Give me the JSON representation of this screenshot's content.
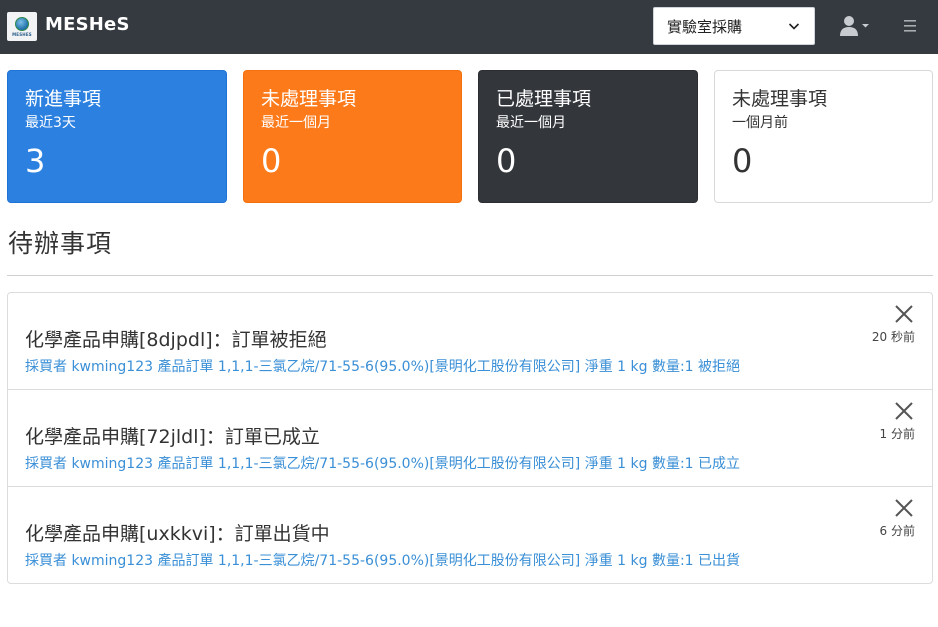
{
  "navbar": {
    "logo_text": "MESHES",
    "brand": "MESHeS",
    "role_select": "實驗室採購",
    "user_icon": "user-icon",
    "menu_icon": "hamburger-icon"
  },
  "cards": [
    {
      "title": "新進事項",
      "subtitle": "最近3天",
      "count": "3",
      "color": "#2b80e0"
    },
    {
      "title": "未處理事項",
      "subtitle": "最近一個月",
      "count": "0",
      "color": "#fd7a1a"
    },
    {
      "title": "已處理事項",
      "subtitle": "最近一個月",
      "count": "0",
      "color": "#33373c"
    },
    {
      "title": "未處理事項",
      "subtitle": "一個月前",
      "count": "0",
      "color": "#ffffff"
    }
  ],
  "section_title": "待辦事項",
  "todos": [
    {
      "title": "化學產品申購[8djpdl]：訂單被拒絕",
      "description": "採買者 kwming123 產品訂單 1,1,1-三氯乙烷/71-55-6(95.0%)[景明化工股份有限公司] 淨重 1 kg 數量:1 被拒絕",
      "time": "20 秒前"
    },
    {
      "title": "化學產品申購[72jldl]：訂單已成立",
      "description": "採買者 kwming123 產品訂單 1,1,1-三氯乙烷/71-55-6(95.0%)[景明化工股份有限公司] 淨重 1 kg 數量:1 已成立",
      "time": "1 分前"
    },
    {
      "title": "化學產品申購[uxkkvi]：訂單出貨中",
      "description": "採買者 kwming123 產品訂單 1,1,1-三氯乙烷/71-55-6(95.0%)[景明化工股份有限公司] 淨重 1 kg 數量:1 已出貨",
      "time": "6 分前"
    }
  ]
}
